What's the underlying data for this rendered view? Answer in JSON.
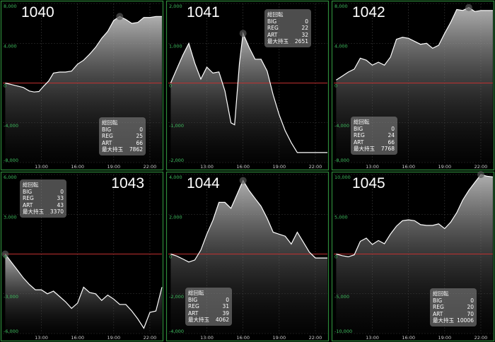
{
  "colors": {
    "frame": "#2e8a3a",
    "grid": "#3a3a3a",
    "zero": "#c03030",
    "line": "#ffffff",
    "axis_label": "#3fc060"
  },
  "stat_labels": {
    "title": "総回転",
    "big": "BIG",
    "reg": "REG",
    "art": "ART",
    "max": "最大持玉"
  },
  "chart_data": [
    {
      "type": "area",
      "machine": "1040",
      "name_pos": "top-left",
      "stats_pos": "bottom-right",
      "ylim": [
        -8000,
        8000
      ],
      "yticks": [
        -8000,
        -4000,
        0,
        4000,
        8000
      ],
      "yticklabels": [
        "-8,000",
        "-4,000",
        "0",
        "4,000",
        "8,000"
      ],
      "xlim": [
        9.8,
        23
      ],
      "xticks": [
        13,
        16,
        19,
        22
      ],
      "xticklabels": [
        "13:00",
        "16:00",
        "19:00",
        "22:00"
      ],
      "x": [
        10,
        10.5,
        11,
        11.5,
        12,
        12.4,
        12.8,
        13.2,
        13.6,
        14,
        14.5,
        15,
        15.5,
        16,
        16.5,
        17,
        17.5,
        18,
        18.5,
        19,
        19.5,
        20,
        20.5,
        21,
        21.5,
        22,
        22.5,
        23
      ],
      "y": [
        0,
        -150,
        -300,
        -450,
        -800,
        -900,
        -850,
        -300,
        200,
        1000,
        1100,
        1100,
        1200,
        1900,
        2300,
        2900,
        3600,
        4500,
        5200,
        6300,
        6700,
        6400,
        6000,
        6100,
        6600,
        6600,
        6700,
        6700
      ],
      "stats": {
        "big": "0",
        "reg": "25",
        "art": "66",
        "max": "7862"
      }
    },
    {
      "type": "area",
      "machine": "1041",
      "name_pos": "top-left",
      "stats_pos": "top-right",
      "ylim": [
        -2000,
        2000
      ],
      "yticks": [
        -2000,
        -1000,
        0,
        1000,
        2000
      ],
      "yticklabels": [
        "-2,000",
        "-1,000",
        "0",
        "1,000",
        "2,000"
      ],
      "xlim": [
        9.8,
        23
      ],
      "xticks": [
        13,
        16,
        19,
        22
      ],
      "xticklabels": [
        "13:00",
        "16:00",
        "19:00",
        "22:00"
      ],
      "x": [
        10,
        10.5,
        11,
        11.5,
        12,
        12.5,
        13,
        13.5,
        14,
        14.5,
        15,
        15.3,
        15.7,
        16,
        16.5,
        17,
        17.5,
        18,
        18.5,
        19,
        19.5,
        20,
        20.5,
        21,
        21.5,
        22,
        22.5,
        23
      ],
      "y": [
        0,
        350,
        700,
        1000,
        500,
        100,
        400,
        250,
        280,
        -200,
        -1000,
        -1050,
        500,
        1250,
        900,
        600,
        600,
        300,
        -300,
        -800,
        -1200,
        -1500,
        -1750,
        -1750,
        -1750,
        -1750,
        -1750,
        -1750
      ],
      "stats": {
        "big": "0",
        "reg": "22",
        "art": "32",
        "max": "2651"
      }
    },
    {
      "type": "area",
      "machine": "1042",
      "name_pos": "top-left",
      "stats_pos": "bottom-left",
      "ylim": [
        -8000,
        8000
      ],
      "yticks": [
        -8000,
        -4000,
        0,
        4000,
        8000
      ],
      "yticklabels": [
        "-8,000",
        "-4,000",
        "0",
        "4,000",
        "8,000"
      ],
      "xlim": [
        9.8,
        23
      ],
      "xticks": [
        13,
        16,
        19,
        22
      ],
      "xticklabels": [
        "13:00",
        "16:00",
        "19:00",
        "22:00"
      ],
      "x": [
        10,
        10.5,
        11,
        11.5,
        12,
        12.5,
        13,
        13.5,
        14,
        14.5,
        15,
        15.5,
        16,
        16.5,
        17,
        17.5,
        18,
        18.5,
        19,
        19.5,
        20,
        20.5,
        21,
        21.5,
        22,
        22.5,
        23
      ],
      "y": [
        300,
        700,
        1100,
        1400,
        2500,
        2300,
        1800,
        2100,
        1800,
        2600,
        4400,
        4600,
        4500,
        4200,
        3900,
        4000,
        3500,
        3800,
        5000,
        6100,
        7400,
        7300,
        7600,
        7200,
        7300,
        7300,
        7300
      ],
      "stats": {
        "big": "0",
        "reg": "24",
        "art": "66",
        "max": "7768"
      }
    },
    {
      "type": "area",
      "machine": "1043",
      "name_pos": "top-right",
      "stats_pos": "top-left",
      "ylim": [
        -6000,
        6000
      ],
      "yticks": [
        -6000,
        -3000,
        0,
        3000,
        6000
      ],
      "yticklabels": [
        "-6,000",
        "-3,000",
        "0",
        "3,000",
        "6,000"
      ],
      "xlim": [
        9.8,
        23
      ],
      "xticks": [
        13,
        16,
        19,
        22
      ],
      "xticklabels": [
        "13:00",
        "16:00",
        "19:00",
        "22:00"
      ],
      "x": [
        10,
        10.5,
        11,
        11.5,
        12,
        12.5,
        13,
        13.5,
        14,
        14.5,
        15,
        15.5,
        16,
        16.5,
        17,
        17.5,
        18,
        18.5,
        19,
        19.5,
        20,
        20.5,
        21,
        21.5,
        22,
        22.5,
        23
      ],
      "y": [
        0,
        -600,
        -1200,
        -1800,
        -2300,
        -2700,
        -2700,
        -3000,
        -2800,
        -3200,
        -3600,
        -4100,
        -3700,
        -2500,
        -2900,
        -3000,
        -3500,
        -3100,
        -3400,
        -3800,
        -3800,
        -4300,
        -4900,
        -5600,
        -4400,
        -4300,
        -2500
      ],
      "stats": {
        "big": "0",
        "reg": "33",
        "art": "43",
        "max": "3370"
      }
    },
    {
      "type": "area",
      "machine": "1044",
      "name_pos": "top-left",
      "stats_pos": "bottom-left",
      "ylim": [
        -4000,
        4000
      ],
      "yticks": [
        -4000,
        -2000,
        0,
        2000,
        4000
      ],
      "yticklabels": [
        "-4,000",
        "-2,000",
        "0",
        "2,000",
        "4,000"
      ],
      "xlim": [
        9.8,
        23
      ],
      "xticks": [
        13,
        16,
        19,
        22
      ],
      "xticklabels": [
        "13:00",
        "16:00",
        "19:00",
        "22:00"
      ],
      "x": [
        10,
        10.5,
        11,
        11.5,
        12,
        12.5,
        13,
        13.5,
        14,
        14.5,
        15,
        15.5,
        16,
        16.5,
        17,
        17.5,
        18,
        18.5,
        19,
        19.5,
        20,
        20.5,
        21,
        21.5,
        22,
        22.5,
        23
      ],
      "y": [
        0,
        -100,
        -250,
        -400,
        -300,
        200,
        1000,
        1700,
        2600,
        2600,
        2300,
        3000,
        3700,
        3200,
        2800,
        2400,
        1800,
        1100,
        1000,
        900,
        500,
        1100,
        600,
        100,
        -200,
        -200,
        -200
      ],
      "stats": {
        "big": "0",
        "reg": "31",
        "art": "39",
        "max": "4062"
      }
    },
    {
      "type": "area",
      "machine": "1045",
      "name_pos": "top-left",
      "stats_pos": "bottom-right",
      "ylim": [
        -10000,
        10000
      ],
      "yticks": [
        -10000,
        -5000,
        0,
        5000,
        10000
      ],
      "yticklabels": [
        "-10,000",
        "-5,000",
        "0",
        "5,000",
        "10,000"
      ],
      "xlim": [
        9.8,
        23
      ],
      "xticks": [
        13,
        16,
        19,
        22
      ],
      "xticklabels": [
        "13:00",
        "16:00",
        "19:00",
        "22:00"
      ],
      "x": [
        10,
        10.5,
        11,
        11.5,
        12,
        12.5,
        13,
        13.5,
        14,
        14.5,
        15,
        15.5,
        16,
        16.5,
        17,
        17.5,
        18,
        18.5,
        19,
        19.5,
        20,
        20.5,
        21,
        21.5,
        22,
        22.5,
        23
      ],
      "y": [
        0,
        -200,
        -350,
        -100,
        1600,
        2000,
        1200,
        1700,
        1300,
        2500,
        3500,
        4200,
        4300,
        4200,
        3700,
        3600,
        3600,
        3800,
        3200,
        4000,
        5200,
        6800,
        8000,
        9000,
        10000,
        9800,
        9700
      ],
      "stats": {
        "big": "0",
        "reg": "20",
        "art": "70",
        "max": "10006"
      }
    }
  ]
}
